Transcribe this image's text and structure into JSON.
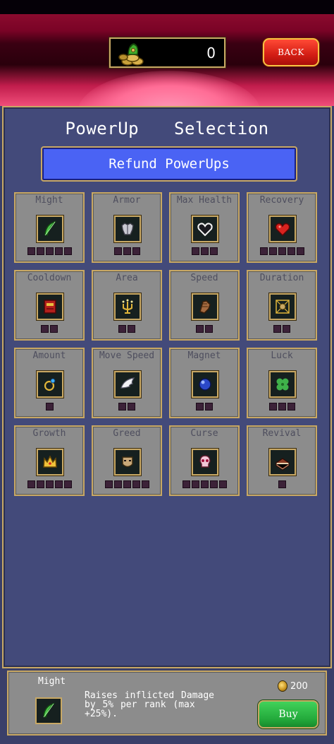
{
  "header": {
    "coins": "0",
    "coin_icon": "coin-pile-icon",
    "back_label": "BACK"
  },
  "panel": {
    "title": "PowerUp  Selection",
    "refund_label": "Refund PowerUps"
  },
  "powerups": [
    {
      "label": "Might",
      "icon": "feather-icon",
      "ranks": 5
    },
    {
      "label": "Armor",
      "icon": "armor-icon",
      "ranks": 3
    },
    {
      "label": "Max Health",
      "icon": "heart-outline-icon",
      "ranks": 3
    },
    {
      "label": "Recovery",
      "icon": "heart-red-icon",
      "ranks": 5
    },
    {
      "label": "Cooldown",
      "icon": "tome-icon",
      "ranks": 2
    },
    {
      "label": "Area",
      "icon": "candelabra-icon",
      "ranks": 2
    },
    {
      "label": "Speed",
      "icon": "gauntlet-icon",
      "ranks": 2
    },
    {
      "label": "Duration",
      "icon": "spellbinder-icon",
      "ranks": 2
    },
    {
      "label": "Amount",
      "icon": "ring-icon",
      "ranks": 1
    },
    {
      "label": "Move Speed",
      "icon": "wings-icon",
      "ranks": 2
    },
    {
      "label": "Magnet",
      "icon": "orb-icon",
      "ranks": 2
    },
    {
      "label": "Luck",
      "icon": "clover-icon",
      "ranks": 3
    },
    {
      "label": "Growth",
      "icon": "crown-icon",
      "ranks": 5
    },
    {
      "label": "Greed",
      "icon": "mask-icon",
      "ranks": 5
    },
    {
      "label": "Curse",
      "icon": "skull-icon",
      "ranks": 5
    },
    {
      "label": "Revival",
      "icon": "tiragisu-icon",
      "ranks": 1
    }
  ],
  "detail": {
    "name": "Might",
    "icon": "feather-icon",
    "description": "Raises inflicted Damage by 5% per rank (max +25%).",
    "price": "200",
    "buy_label": "Buy"
  },
  "colors": {
    "panel": "#434a7a",
    "card": "#8c8c8c",
    "border_gold": "#c8a864",
    "refund_blue": "#4a63f4",
    "back_red": "#d31d14",
    "buy_green": "#23a93b"
  }
}
